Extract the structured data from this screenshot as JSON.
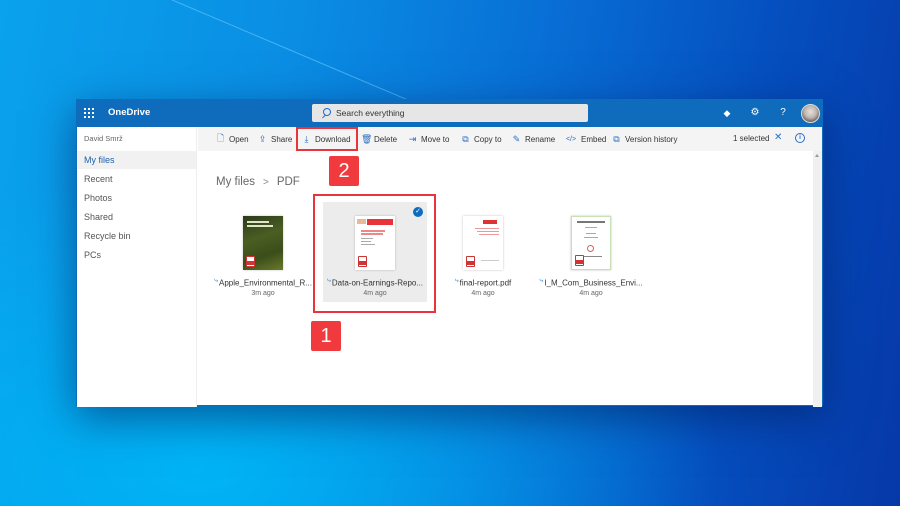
{
  "app": {
    "name": "OneDrive",
    "search_placeholder": "Search everything"
  },
  "topbar_icons": [
    "diamond-icon",
    "gear-icon",
    "help-icon",
    "avatar"
  ],
  "topbar_glyphs": {
    "diamond": "◆",
    "gear": "⚙",
    "help": "?"
  },
  "sidebar": {
    "user": "David Smrž",
    "items": [
      {
        "label": "My files",
        "active": true
      },
      {
        "label": "Recent"
      },
      {
        "label": "Photos"
      },
      {
        "label": "Shared"
      },
      {
        "label": "Recycle bin"
      },
      {
        "label": "PCs"
      }
    ]
  },
  "commandbar": {
    "items": [
      {
        "label": "Open",
        "icon": "🗋",
        "icon_name": "file-icon"
      },
      {
        "label": "Share",
        "icon": "⇪",
        "icon_name": "share-icon"
      },
      {
        "label": "Download",
        "icon": "⤓",
        "icon_name": "download-icon"
      },
      {
        "label": "Delete",
        "icon": "🗑",
        "icon_name": "trash-icon"
      },
      {
        "label": "Move to",
        "icon": "⇥",
        "icon_name": "move-icon"
      },
      {
        "label": "Copy to",
        "icon": "⧉",
        "icon_name": "copy-icon"
      },
      {
        "label": "Rename",
        "icon": "✎",
        "icon_name": "rename-icon"
      },
      {
        "label": "Embed",
        "icon": "</>",
        "icon_name": "embed-icon"
      },
      {
        "label": "Version history",
        "icon": "⧉",
        "icon_name": "version-history-icon"
      }
    ],
    "selected_label": "1 selected",
    "close_glyph": "✕",
    "info_glyph": "i"
  },
  "breadcrumb": {
    "root": "My files",
    "separator": ">",
    "current": "PDF"
  },
  "files": [
    {
      "name": "Apple_Environmental_R...",
      "time": "3m ago",
      "selected": false
    },
    {
      "name": "Data-on-Earnings-Repo...",
      "time": "4m ago",
      "selected": true
    },
    {
      "name": "final-report.pdf",
      "time": "4m ago",
      "selected": false
    },
    {
      "name": "I_M_Com_Business_Envi...",
      "time": "4m ago",
      "selected": false
    }
  ],
  "annotations": {
    "step1": "1",
    "step2": "2",
    "highlight_color": "#e8353b"
  },
  "colors": {
    "brand_blue": "#0f6cbd",
    "accent_red": "#f03a3e"
  }
}
